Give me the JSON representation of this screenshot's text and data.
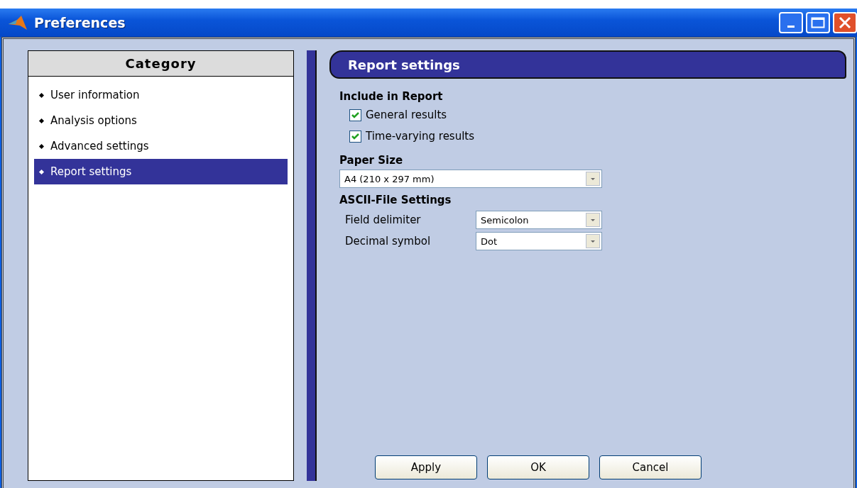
{
  "window": {
    "title": "Preferences"
  },
  "sidebar": {
    "header": "Category",
    "items": [
      {
        "label": "User information",
        "selected": false
      },
      {
        "label": "Analysis options",
        "selected": false
      },
      {
        "label": "Advanced settings",
        "selected": false
      },
      {
        "label": "Report settings",
        "selected": true
      }
    ]
  },
  "panel": {
    "title": "Report settings",
    "include": {
      "heading": "Include in Report",
      "options": [
        {
          "label": "General results",
          "checked": true
        },
        {
          "label": "Time-varying results",
          "checked": true
        }
      ]
    },
    "paper": {
      "heading": "Paper Size",
      "value": "A4 (210 x 297 mm)"
    },
    "ascii": {
      "heading": "ASCII-File Settings",
      "fields": [
        {
          "label": "Field delimiter",
          "value": "Semicolon"
        },
        {
          "label": "Decimal symbol",
          "value": "Dot"
        }
      ]
    }
  },
  "buttons": [
    "Apply",
    "OK",
    "Cancel"
  ]
}
